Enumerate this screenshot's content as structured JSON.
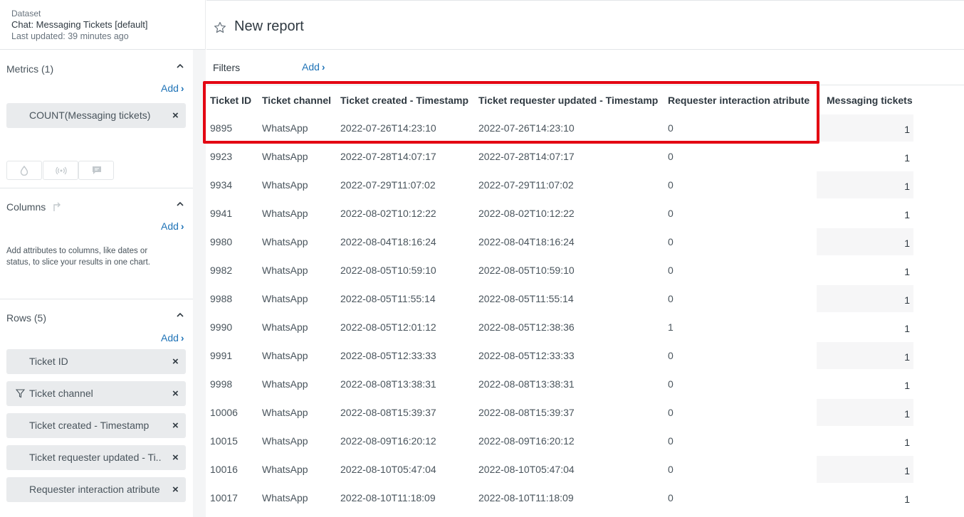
{
  "dataset": {
    "label": "Dataset",
    "name": "Chat: Messaging Tickets [default]",
    "last_updated": "Last updated: 39 minutes ago"
  },
  "metrics": {
    "title": "Metrics (1)",
    "add": "Add",
    "items": [
      "COUNT(Messaging tickets)"
    ]
  },
  "columns": {
    "title": "Columns",
    "add": "Add",
    "hint": "Add attributes to columns, like dates or status, to slice your results in one chart."
  },
  "rows": {
    "title": "Rows (5)",
    "add": "Add",
    "items": [
      "Ticket ID",
      "Ticket channel",
      "Ticket created - Timestamp",
      "Ticket requester updated - Ti...",
      "Requester interaction atribute"
    ]
  },
  "report": {
    "title": "New report"
  },
  "filters": {
    "label": "Filters",
    "add": "Add"
  },
  "table": {
    "headers": [
      "Ticket ID",
      "Ticket channel",
      "Ticket created - Timestamp",
      "Ticket requester updated - Timestamp",
      "Requester interaction atribute",
      "Messaging tickets"
    ],
    "rows": [
      [
        "9895",
        "WhatsApp",
        "2022-07-26T14:23:10",
        "2022-07-26T14:23:10",
        "0",
        "1"
      ],
      [
        "9923",
        "WhatsApp",
        "2022-07-28T14:07:17",
        "2022-07-28T14:07:17",
        "0",
        "1"
      ],
      [
        "9934",
        "WhatsApp",
        "2022-07-29T11:07:02",
        "2022-07-29T11:07:02",
        "0",
        "1"
      ],
      [
        "9941",
        "WhatsApp",
        "2022-08-02T10:12:22",
        "2022-08-02T10:12:22",
        "0",
        "1"
      ],
      [
        "9980",
        "WhatsApp",
        "2022-08-04T18:16:24",
        "2022-08-04T18:16:24",
        "0",
        "1"
      ],
      [
        "9982",
        "WhatsApp",
        "2022-08-05T10:59:10",
        "2022-08-05T10:59:10",
        "0",
        "1"
      ],
      [
        "9988",
        "WhatsApp",
        "2022-08-05T11:55:14",
        "2022-08-05T11:55:14",
        "0",
        "1"
      ],
      [
        "9990",
        "WhatsApp",
        "2022-08-05T12:01:12",
        "2022-08-05T12:38:36",
        "1",
        "1"
      ],
      [
        "9991",
        "WhatsApp",
        "2022-08-05T12:33:33",
        "2022-08-05T12:33:33",
        "0",
        "1"
      ],
      [
        "9998",
        "WhatsApp",
        "2022-08-08T13:38:31",
        "2022-08-08T13:38:31",
        "0",
        "1"
      ],
      [
        "10006",
        "WhatsApp",
        "2022-08-08T15:39:37",
        "2022-08-08T15:39:37",
        "0",
        "1"
      ],
      [
        "10015",
        "WhatsApp",
        "2022-08-09T16:20:12",
        "2022-08-09T16:20:12",
        "0",
        "1"
      ],
      [
        "10016",
        "WhatsApp",
        "2022-08-10T05:47:04",
        "2022-08-10T05:47:04",
        "0",
        "1"
      ],
      [
        "10017",
        "WhatsApp",
        "2022-08-10T11:18:09",
        "2022-08-10T11:18:09",
        "0",
        "1"
      ]
    ]
  },
  "colors": {
    "link": "#1f73b7",
    "highlight": "#e30613",
    "pill": "#e9ebed"
  }
}
